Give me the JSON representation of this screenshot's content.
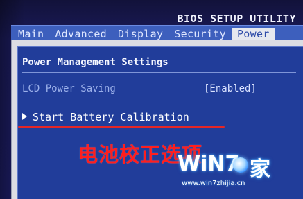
{
  "header": {
    "title": "BIOS SETUP UTILITY"
  },
  "menu": {
    "items": [
      "Main",
      "Advanced",
      "Display",
      "Security",
      "Power"
    ],
    "active": "Power"
  },
  "panel": {
    "section_title": "Power Management Settings",
    "lcd_power_saving": {
      "label": "LCD Power Saving",
      "value": "[Enabled]"
    },
    "battery_calibration": {
      "label": "Start Battery Calibration"
    }
  },
  "annotation": {
    "text": "电池校正选项",
    "color": "#ff1e1e"
  },
  "watermark": {
    "brand": "WiN7",
    "logo_name": "windows-logo",
    "suffix": "家",
    "url": "www.win7zhijia.cn"
  },
  "colors": {
    "panel_blue": "#213d9a",
    "menu_bar": "#3d5fbd",
    "active_tab_bg": "#e6e8ef",
    "underline_red": "#e52626"
  }
}
